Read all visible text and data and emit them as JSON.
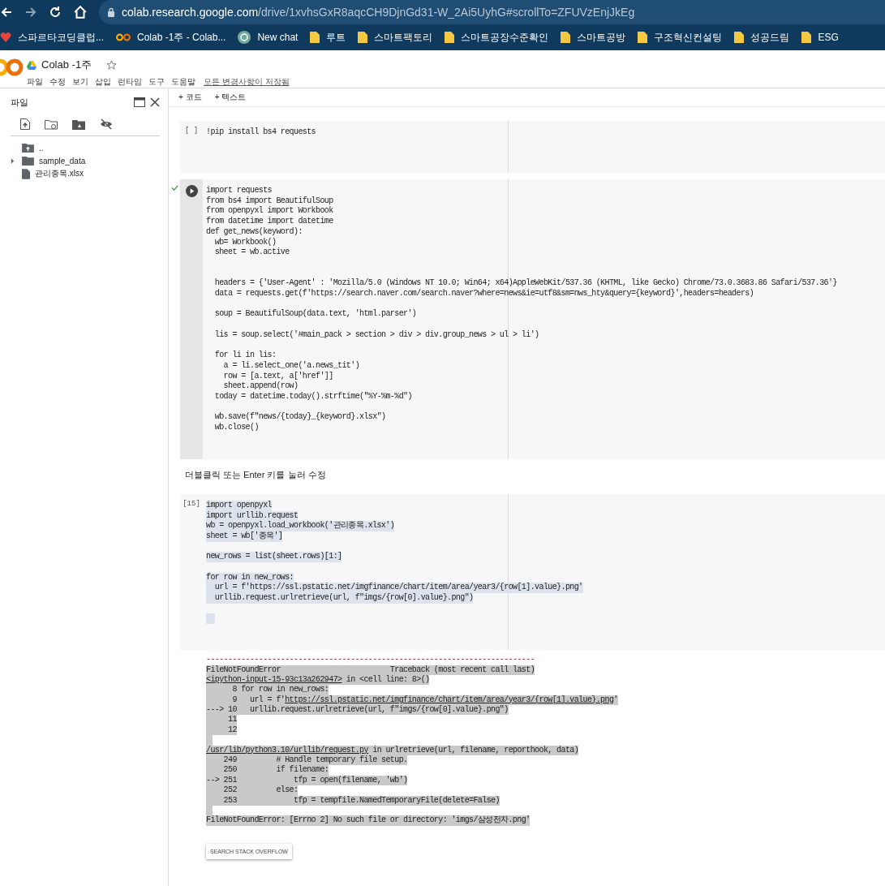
{
  "browser": {
    "address": {
      "host": "colab.research.google.com",
      "path": "/drive/1xvhsGxR8aqcCH9DjnGd31-W_2Ai5UyhG#scrollTo=ZFUVzEnjJkEg"
    },
    "bookmarks": [
      {
        "label": "스파르타코딩클럽...",
        "kind": "site"
      },
      {
        "label": "Colab -1주 - Colab...",
        "kind": "colab"
      },
      {
        "label": "New chat",
        "kind": "chat"
      },
      {
        "label": "루트",
        "kind": "folder"
      },
      {
        "label": "스마트팩토리",
        "kind": "folder"
      },
      {
        "label": "스마트공장수준확인",
        "kind": "folder"
      },
      {
        "label": "스마트공방",
        "kind": "folder"
      },
      {
        "label": "구조혁신컨설팅",
        "kind": "folder"
      },
      {
        "label": "성공드림",
        "kind": "folder"
      },
      {
        "label": "ESG",
        "kind": "folder"
      }
    ]
  },
  "notebook": {
    "title": "Colab -1주",
    "menu": [
      "파일",
      "수정",
      "보기",
      "삽입",
      "런타임",
      "도구",
      "도움말"
    ],
    "save_status": "모든 변경사항이 저장됨",
    "toolbar": [
      "+ 코드",
      "+ 텍스트"
    ]
  },
  "files_panel": {
    "title": "파일",
    "tree": [
      {
        "name": "..",
        "kind": "parent"
      },
      {
        "name": "sample_data",
        "kind": "folder",
        "expanded": false
      },
      {
        "name": "관리종목.xlsx",
        "kind": "file"
      }
    ]
  },
  "cells": [
    {
      "kind": "code",
      "count": "[ ]",
      "focused": false,
      "success": false,
      "highlighted": false,
      "code": "!pip install bs4 requests"
    },
    {
      "kind": "code",
      "focused": true,
      "success": true,
      "highlighted": false,
      "code": "import requests\nfrom bs4 import BeautifulSoup\nfrom openpyxl import Workbook\nfrom datetime import datetime\ndef get_news(keyword):\n  wb= Workbook()\n  sheet = wb.active\n\n\n  headers = {'User-Agent' : 'Mozilla/5.0 (Windows NT 10.0; Win64; x64)AppleWebKit/537.36 (KHTML, like Gecko) Chrome/73.0.3683.86 Safari/537.36'}\n  data = requests.get(f'https://search.naver.com/search.naver?where=news&ie=utf8&sm=nws_hty&query={keyword}',headers=headers)\n\n  soup = BeautifulSoup(data.text, 'html.parser')\n\n  lis = soup.select('#main_pack > section > div > div.group_news > ul > li')\n\n  for li in lis:\n    a = li.select_one('a.news_tit')\n    row = [a.text, a['href']]\n    sheet.append(row)\n  today = datetime.today().strftime(\"%Y-%m-%d\")\n\n  wb.save(f\"news/{today}_{keyword}.xlsx\")\n  wb.close()"
    },
    {
      "kind": "text",
      "text": "더블클릭 또는 Enter 키를 눌러 수정"
    },
    {
      "kind": "code",
      "count": "[15]",
      "focused": false,
      "success": false,
      "highlighted": true,
      "code": "import openpyxl\nimport urllib.request\nwb = openpyxl.load_workbook('관리종목.xlsx')\nsheet = wb['종목']\n\nnew_rows = list(sheet.rows)[1:]\n\nfor row in new_rows:\n  url = f'https://ssl.pstatic.net/imgfinance/chart/item/area/year3/{row[1].value}.png'\n  urllib.request.urlretrieve(url, f\"imgs/{row[0].value}.png\")\n\n  ",
      "output": {
        "highlighted": true,
        "button": "SEARCH STACK OVERFLOW",
        "lines": [
          {
            "kind": "error-rule",
            "pre": "---------------------------------------------------------------------------"
          },
          {
            "kind": "text",
            "pre": "FileNotFoundError                         Traceback (most recent call last)"
          },
          {
            "kind": "text",
            "link": "<ipython-input-15-93c13a262947>",
            "post": " in <cell line: 8>()"
          },
          {
            "kind": "text",
            "pre": "      8 for row in new_rows:"
          },
          {
            "kind": "text",
            "pre": "      9   url = f'",
            "link": "https://ssl.pstatic.net/imgfinance/chart/item/area/year3/{row[1].value}.png",
            "post": "'"
          },
          {
            "kind": "text",
            "pre": "---> 10   urllib.request.urlretrieve(url, f\"imgs/{row[0].value}.png\")"
          },
          {
            "kind": "text",
            "pre": "     11"
          },
          {
            "kind": "text",
            "pre": "     12"
          },
          {
            "kind": "blank"
          },
          {
            "kind": "text",
            "link": "/usr/lib/python3.10/urllib/request.py",
            "post": " in urlretrieve(url, filename, reporthook, data)"
          },
          {
            "kind": "text",
            "pre": "    249         # Handle temporary file setup."
          },
          {
            "kind": "text",
            "pre": "    250         if filename:"
          },
          {
            "kind": "text",
            "pre": "--> 251             tfp = open(filename, 'wb')"
          },
          {
            "kind": "text",
            "pre": "    252         else:"
          },
          {
            "kind": "text",
            "pre": "    253             tfp = tempfile.NamedTemporaryFile(delete=False)"
          },
          {
            "kind": "blank"
          },
          {
            "kind": "text",
            "pre": "FileNotFoundError: [Errno 2] No such file or directory: 'imgs/삼성전자.png'"
          }
        ]
      }
    }
  ]
}
